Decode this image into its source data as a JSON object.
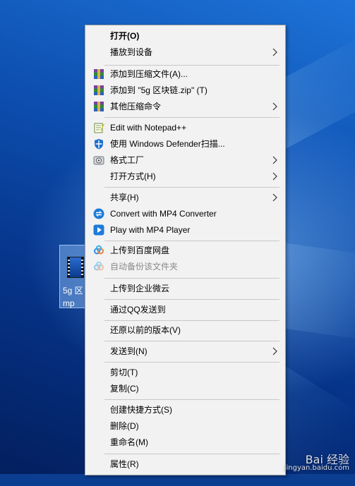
{
  "desktop_file": {
    "label": "5g 区\nmp"
  },
  "menu": {
    "open": "打开(O)",
    "cast_to_device": "播放到设备",
    "add_to_archive": "添加到压缩文件(A)...",
    "add_to_zip": "添加到 \"5g  区块链.zip\" (T)",
    "other_compress": "其他压缩命令",
    "edit_notepadpp": "Edit with Notepad++",
    "defender_scan": "使用 Windows Defender扫描...",
    "format_factory": "格式工厂",
    "open_with": "打开方式(H)",
    "share": "共享(H)",
    "convert_mp4": "Convert with MP4 Converter",
    "play_mp4": "Play with MP4 Player",
    "upload_baidu": "上传到百度网盘",
    "auto_backup": "自动备份该文件夹",
    "upload_wecom": "上传到企业微云",
    "send_qq": "通过QQ发送到",
    "restore_versions": "还原以前的版本(V)",
    "send_to": "发送到(N)",
    "cut": "剪切(T)",
    "copy": "复制(C)",
    "create_shortcut": "创建快捷方式(S)",
    "delete": "删除(D)",
    "rename": "重命名(M)",
    "properties": "属性(R)"
  },
  "watermark": {
    "brand": "Bai 经验",
    "url": "jingyan.baidu.com"
  },
  "colors": {
    "menu_bg": "#f2f2f2",
    "accent_blue": "#1e7bd8",
    "separator": "#c8c8c8"
  }
}
